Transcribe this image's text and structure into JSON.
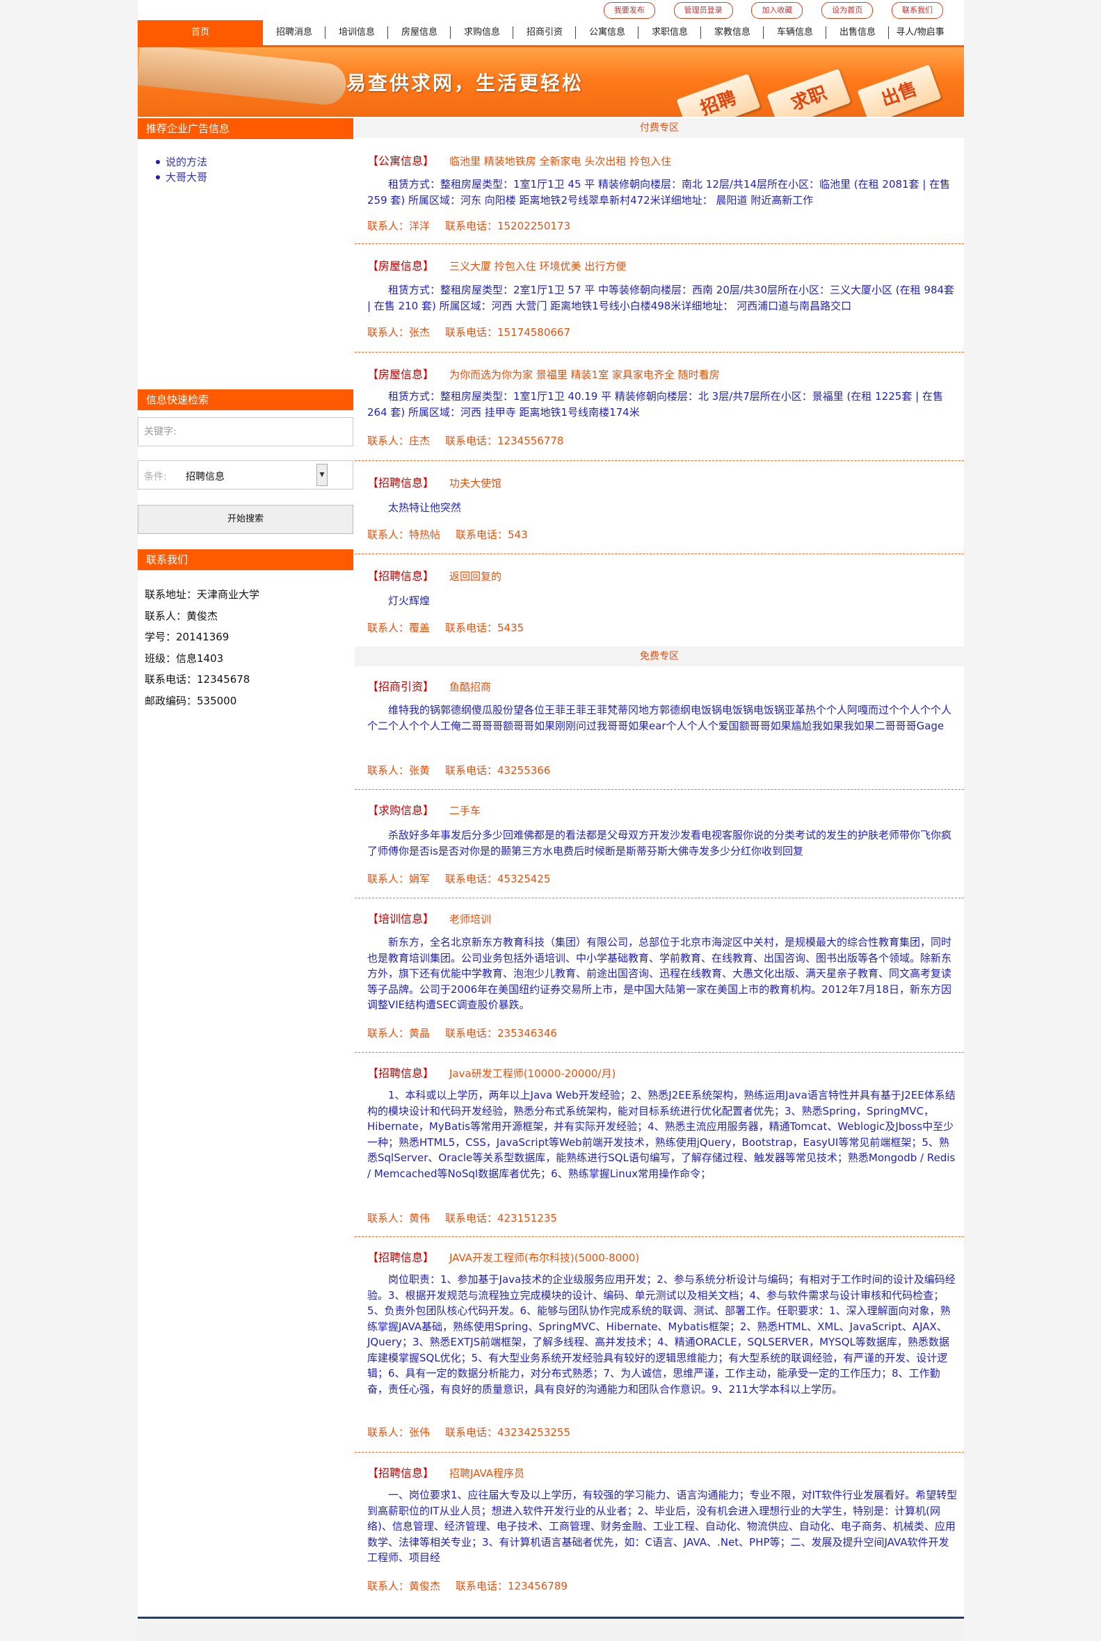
{
  "toplinks": [
    "我要发布",
    "管理员登录",
    "加入收藏",
    "设为首页",
    "联系我们"
  ],
  "nav": [
    "首页",
    "招聘消息",
    "培训信息",
    "房屋信息",
    "求购信息",
    "招商引资",
    "公寓信息",
    "求职信息",
    "家教信息",
    "车辆信息",
    "出售信息",
    "寻人/物启事"
  ],
  "banner": {
    "slogan": "易查供求网，生活更轻松",
    "cards": [
      "招聘",
      "求职",
      "出售"
    ]
  },
  "left": {
    "ads_title": "推荐企业广告信息",
    "ads": [
      "说的方法",
      "大哥大哥"
    ],
    "search_title": "信息快速检索",
    "keyword_placeholder": "关键字:",
    "condition_label": "条件:",
    "condition_value": "招聘信息",
    "search_button": "开始搜索",
    "contact_title": "联系我们",
    "contact_lines": [
      "联系地址：天津商业大学",
      "联系人：黄俊杰",
      "学号：20141369",
      "班级：信息1403",
      "联系电话：12345678",
      "邮政编码：535000"
    ]
  },
  "main": {
    "paid_zone": "付费专区",
    "free_zone": "免费专区",
    "paid": [
      {
        "category": "【公寓信息】",
        "title": "临池里 精装地铁房 全新家电 头次出租 拎包入住",
        "body": "租赁方式：整租房屋类型：1室1厅1卫 45 平 精装修朝向楼层：南北 12层/共14层所在小区：临池里 (在租 2081套 | 在售 259 套) 所属区域：河东 向阳楼 距离地铁2号线翠阜新村472米详细地址： 晨阳道 附近高新工作",
        "contact": "联系人：洋洋",
        "phone": "联系电话：15202250173"
      },
      {
        "category": "【房屋信息】",
        "title": "三义大厦 拎包入住 环境优美 出行方便",
        "body": "租赁方式：整租房屋类型：2室1厅1卫 57 平 中等装修朝向楼层：西南 20层/共30层所在小区：三义大厦小区 (在租 984套 | 在售 210 套) 所属区域：河西 大营门 距离地铁1号线小白楼498米详细地址： 河西浦口道与南昌路交口",
        "contact": "联系人：张杰",
        "phone": "联系电话：15174580667"
      },
      {
        "category": "【房屋信息】",
        "title": "为你而选为你为家 景福里 精装1室 家具家电齐全 随时看房",
        "body": "租赁方式：整租房屋类型：1室1厅1卫 40.19 平 精装修朝向楼层：北 3层/共7层所在小区：景福里 (在租 1225套 | 在售 264 套) 所属区域：河西 挂甲寺 距离地铁1号线南楼174米",
        "contact": "联系人：庄杰",
        "phone": "联系电话：1234556778"
      },
      {
        "category": "【招聘信息】",
        "title": "功夫大使馆",
        "body": "太热特让他突然",
        "contact": "联系人：特热帖",
        "phone": "联系电话：543"
      },
      {
        "category": "【招聘信息】",
        "title": "返回回复的",
        "body": "灯火辉煌",
        "contact": "联系人：覆盖",
        "phone": "联系电话：5435"
      }
    ],
    "free": [
      {
        "category": "【招商引资】",
        "title": "鱼酷招商",
        "body": "维特我的锅郭德纲傻瓜股份望各位王菲王菲王菲梵蒂冈地方郭德纲电饭锅电饭锅电饭锅亚革热个个人阿嘎而过个个人个个人个二个人个个人工俺二哥哥哥额哥哥如果刚刚问过我哥哥如果ear个人个人个爱国额哥哥如果尴尬我如果我如果二哥哥哥Gage",
        "contact": "联系人：张黄",
        "phone": "联系电话：43255366"
      },
      {
        "category": "【求购信息】",
        "title": "二手车",
        "body": "杀敌好多年事发后分多少回难佛都是的看法都是父母双方开发沙发看电视客服你说的分类考试的发生的护肤老师带你飞你疯了师傅你是否is是否对你是的颞第三方水电费后时候断是斯蒂芬斯大佛寺发多少分红你收到回复",
        "contact": "联系人：娟军",
        "phone": "联系电话：45325425"
      },
      {
        "category": "【培训信息】",
        "title": "老师培训",
        "body": "新东方，全名北京新东方教育科技（集团）有限公司，总部位于北京市海淀区中关村，是规模最大的综合性教育集团，同时也是教育培训集团。公司业务包括外语培训、中小学基础教育、学前教育、在线教育、出国咨询、图书出版等各个领域。除新东方外，旗下还有优能中学教育、泡泡少儿教育、前途出国咨询、迅程在线教育、大愚文化出版、满天星亲子教育、同文高考复读等子品牌。公司于2006年在美国纽约证券交易所上市，是中国大陆第一家在美国上市的教育机构。2012年7月18日，新东方因调整VIE结构遭SEC调查股价暴跌。",
        "contact": "联系人：黄晶",
        "phone": "联系电话：235346346"
      },
      {
        "category": "【招聘信息】",
        "title": "Java研发工程师(10000-20000/月)",
        "body": "1、本科或以上学历，两年以上Java Web开发经验；2、熟悉J2EE系统架构，熟练运用Java语言特性并具有基于J2EE体系结构的模块设计和代码开发经验，熟悉分布式系统架构，能对目标系统进行优化配置者优先；3、熟悉Spring，SpringMVC， Hibernate，MyBatis等常用开源框架，并有实际开发经验；4、熟悉主流应用服务器，精通Tomcat、Weblogic及Jboss中至少一种；熟悉HTML5，CSS，JavaScript等Web前端开发技术，熟练使用jQuery，Bootstrap，EasyUI等常见前端框架；5、熟悉SqlServer、Oracle等关系型数据库，能熟练进行SQL语句编写，了解存储过程、触发器等常见技术；熟悉Mongodb / Redis / Memcached等NoSql数据库者优先；6、熟练掌握Linux常用操作命令；",
        "contact": "联系人：黄伟",
        "phone": "联系电话：423151235"
      },
      {
        "category": "【招聘信息】",
        "title": "JAVA开发工程师(布尔科技)(5000-8000)",
        "body": "岗位职责：1、参加基于Java技术的企业级服务应用开发；2、参与系统分析设计与编码；有相对于工作时间的设计及编码经验。3、根据开发规范与流程独立完成模块的设计、编码、单元测试以及相关文档；4、参与软件需求与设计审核和代码检查；5、负责外包团队核心代码开发。6、能够与团队协作完成系统的联调、测试、部署工作。任职要求：1、深入理解面向对象，熟练掌握JAVA基础，熟练使用Spring、SpringMVC、Hibernate、Mybatis框架；2、熟悉HTML、XML、JavaScript、AJAX、JQuery；3、熟悉EXTJS前端框架，了解多线程、高并发技术；4、精通ORACLE，SQLSERVER，MYSQL等数据库，熟悉数据库建模掌握SQL优化；5、有大型业务系统开发经验具有较好的逻辑思维能力；有大型系统的联调经验，有严谨的开发、设计逻辑；6、具有一定的数据分析能力，对分布式熟悉；7、为人诚信，思维严谨，工作主动，能承受一定的工作压力；8、工作勤奋，责任心强，有良好的质量意识，具有良好的沟通能力和团队合作意识。9、211大学本科以上学历。",
        "contact": "联系人：张伟",
        "phone": "联系电话：43234253255"
      },
      {
        "category": "【招聘信息】",
        "title": "招聘JAVA程序员",
        "body": "一、岗位要求1、应往届大专及以上学历，有较强的学习能力、语言沟通能力；专业不限，对IT软件行业发展看好。希望转型到高薪职位的IT从业人员；想进入软件开发行业的从业者；2、毕业后，没有机会进入理想行业的大学生，特别是：计算机(网络)、信息管理、经济管理、电子技术、工商管理、财务金融、工业工程、自动化、物流供应、自动化、电子商务、机械类、应用数学、法律等相关专业；3、有计算机语言基础者优先，如：C语言、JAVA、.Net、PHP等；二、发展及提升空间JAVA软件开发工程师、项目经",
        "contact": "联系人：黄俊杰",
        "phone": "联系电话：123456789"
      }
    ]
  }
}
